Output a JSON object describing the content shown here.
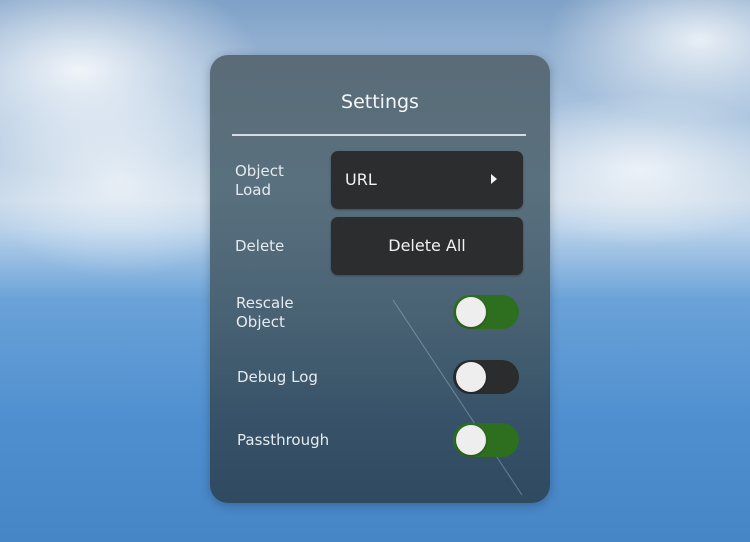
{
  "settings_panel": {
    "title": "Settings",
    "object_load": {
      "label_line1": "Object",
      "label_line2": "Load",
      "value": "URL"
    },
    "delete": {
      "label": "Delete",
      "button_label": "Delete All"
    },
    "rescale_object": {
      "label_line1": "Rescale",
      "label_line2": "Object",
      "enabled": true
    },
    "debug_log": {
      "label": "Debug Log",
      "enabled": false
    },
    "passthrough": {
      "label": "Passthrough",
      "enabled": true
    }
  },
  "colors": {
    "toggle_on": "#2d6e1f",
    "toggle_off": "#2a2c2e",
    "button_bg": "#2b2d2f"
  }
}
